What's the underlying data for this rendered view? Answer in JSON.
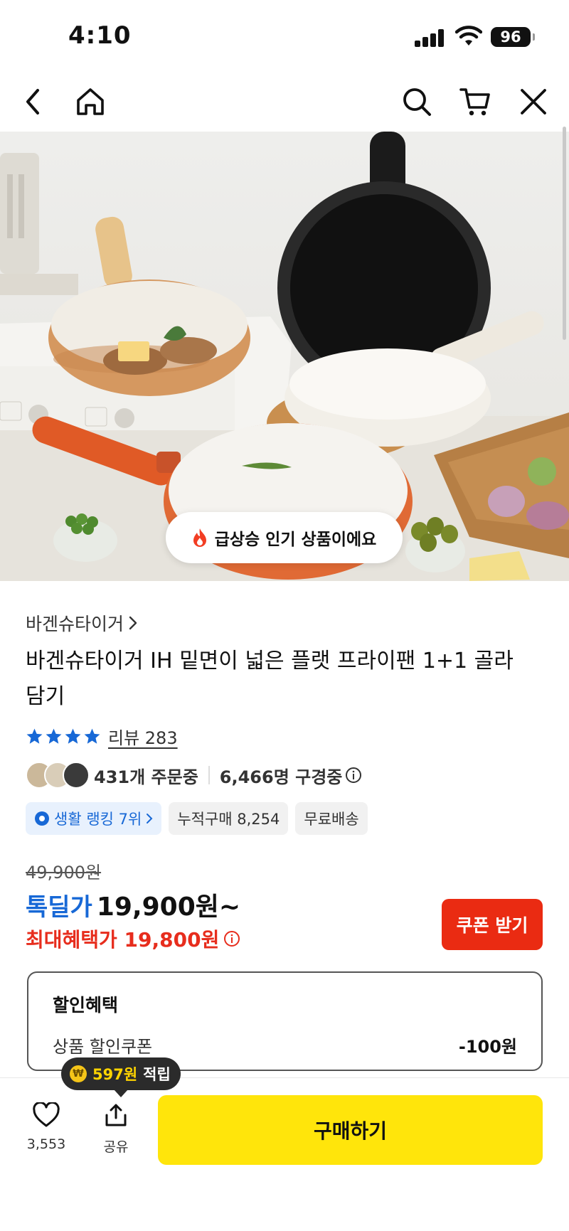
{
  "status_bar": {
    "time": "4:10",
    "battery": "96"
  },
  "hero": {
    "badge_text": "급상승 인기 상품이에요"
  },
  "product": {
    "brand": "바겐슈타이거",
    "title": "바겐슈타이거 IH 밑면이 넓은 플랫 프라이팬 1+1 골라담기",
    "rating_stars": 4,
    "review_label": "리뷰 283",
    "order_count": "431개 주문중",
    "viewer_count": "6,466명 구경중",
    "chips": [
      {
        "label": "생활 랭킹 7위"
      },
      {
        "label": "누적구매 8,254"
      },
      {
        "label": "무료배송"
      }
    ]
  },
  "price": {
    "original": "49,900원",
    "deal_label": "톡딜가",
    "deal_price": "19,900원~",
    "max_benefit": "최대혜택가 19,800원",
    "coupon_button": "쿠폰 받기"
  },
  "discount": {
    "title": "할인혜택",
    "row_label": "상품 할인쿠폰",
    "row_amount": "-100원"
  },
  "bottom": {
    "points_value": "597원",
    "points_label": "적립",
    "like_count": "3,553",
    "share_label": "공유",
    "buy_button": "구매하기"
  },
  "colors": {
    "accent_blue": "#1768d6",
    "accent_red": "#e72d1d",
    "coupon_red": "#ea2b12",
    "buy_yellow": "#ffe50b",
    "star_blue": "#1768d6"
  }
}
